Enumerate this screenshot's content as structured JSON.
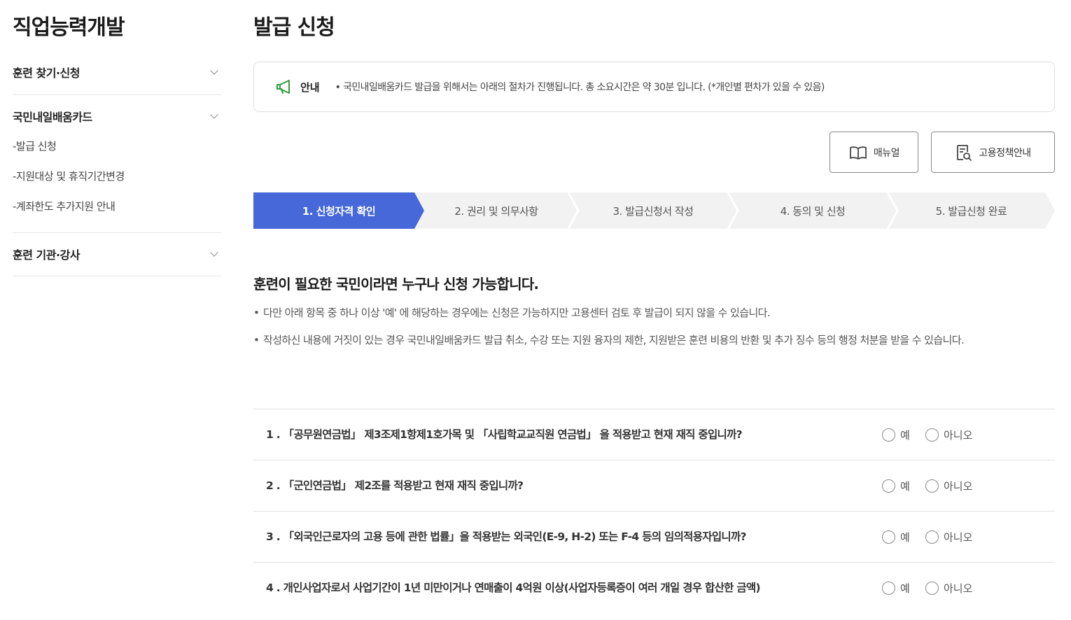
{
  "sidebar": {
    "title": "직업능력개발",
    "sections": [
      {
        "label": "훈련 찾기·신청",
        "expanded": false,
        "items": []
      },
      {
        "label": "국민내일배움카드",
        "expanded": true,
        "items": [
          {
            "label": "-발급 신청"
          },
          {
            "label": "-지원대상 및 휴직기간변경"
          },
          {
            "label": "-계좌한도 추가지원 안내"
          }
        ]
      },
      {
        "label": "훈련 기관·강사",
        "expanded": false,
        "items": []
      }
    ]
  },
  "main": {
    "title": "발급 신청",
    "notice": {
      "icon": "megaphone-icon",
      "label": "안내",
      "text": "• 국민내일배움카드 발급을 위해서는 아래의 절차가 진행됩니다. 총 소요시간은 약 30분 입니다. (*개인별 편차가 있을 수 있음)"
    },
    "buttons": {
      "manual": {
        "label": "매뉴얼",
        "icon": "book-icon"
      },
      "policy": {
        "label": "고용정책안내",
        "icon": "document-search-icon"
      }
    },
    "steps": [
      {
        "label": "1. 신청자격 확인",
        "active": true
      },
      {
        "label": "2. 권리 및 의무사항",
        "active": false
      },
      {
        "label": "3. 발급신청서 작성",
        "active": false
      },
      {
        "label": "4. 동의 및 신청",
        "active": false
      },
      {
        "label": "5. 발급신청 완료",
        "active": false
      }
    ],
    "intro": {
      "title": "훈련이 필요한 국민이라면 누구나 신청 가능합니다.",
      "bullet_mark": "•",
      "bullets": [
        "다만 아래 항목 중 하나 이상 '예' 에 해당하는 경우에는 신청은 가능하지만 고용센터 검토 후 발급이 되지 않을 수 있습니다.",
        "작성하신 내용에 거짓이 있는 경우 국민내일배움카드 발급 취소, 수강 또는 지원 융자의 제한, 지원받은 훈련 비용의 반환 및 추가 징수 등의 행정 처분을 받을 수 있습니다."
      ]
    },
    "questions": [
      {
        "text": "1 . 「공무원연금법」 제3조제1항제1호가목 및 「사립학교교직원 연금법」 을 적용받고 현재 재직 중입니까?",
        "yes": "예",
        "no": "아니오"
      },
      {
        "text": "2 . 「군인연금법」 제2조를 적용받고 현재 재직 중입니까?",
        "yes": "예",
        "no": "아니오"
      },
      {
        "text": "3 . 「외국인근로자의 고용 등에 관한 법률」을 적용받는 외국인(E-9, H-2) 또는 F-4 등의 임의적용자입니까?",
        "yes": "예",
        "no": "아니오"
      },
      {
        "text": "4 . 개인사업자로서 사업기간이 1년 미만이거나 연매출이 4억원 이상(사업자등록증이 여러 개일 경우 합산한 금액)",
        "yes": "예",
        "no": "아니오"
      }
    ],
    "colors": {
      "accent": "#4668d8",
      "step_inactive": "#f2f2f2",
      "notice_icon": "#2f9a3a"
    }
  }
}
